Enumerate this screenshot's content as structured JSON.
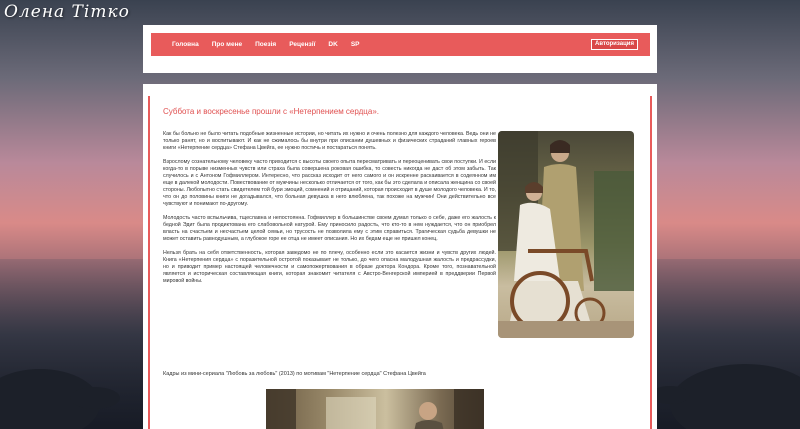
{
  "site": {
    "logo": "Олена Тітко"
  },
  "nav": {
    "items": [
      {
        "label": "Головна"
      },
      {
        "label": "Про мене"
      },
      {
        "label": "Поезія"
      },
      {
        "label": "Рецензії"
      },
      {
        "label": "DK"
      },
      {
        "label": "SP"
      }
    ],
    "auth_label": "Авторизация"
  },
  "article": {
    "title": "Суббота и воскресенье прошли с «Нетерпением сердца».",
    "paragraphs": [
      "Как бы больно не было читать подобные жизненные истории, но читать их нужно и очень полезно для каждого человека. Ведь они не только ранят, но и воспитывают. И как не сжималось бы внутри при описании душевных и физических страданий главных героев книги «Нетерпение сердца» Стефана Цвейга, ее нужно постичь и постараться понять.",
      "Взрослому сознательному человеку часто приходится с высоты своего опыта пересматривать и переоценивать свои поступки. И если когда-то в порыве низменных чувств или страха была совершена роковая ошибка, то совесть никогда не даст об этом забыть. Так случилось и с Антоном Гофмиллером. Интересно, что рассказ исходит от него самого и он искренне раскаивается в содеянном им еще в далекой молодости. Повествование от мужчины несколько отличается от того, как бы это сделала и описала женщина со своей стороны. Любопытно стать свидетелем той бури эмоций, сомнений и отрицаний, которая происходит в душе молодого человека. И то, что он до половины книги не догадывался, что больная девушка в него влюблена, так похоже на мужчин! Они действительно все чувствуют и понимают по-другому.",
      "Молодость часто вспыльчива, тщеславна и непостоянна. Гофмиллер в большинстве своем думал только о себе, даже его жалость к бедной Эдит была продиктована его слабовольной натурой. Ему приносило радость, что кто-то в нем нуждается, что он приобрел власть на счастьем и несчастьем целой семьи, но трусость не позволила ему с этим справиться. Трагическая судьба девушки не может оставить равнодушным, а глубокое горе ее отца не имеет описания. Но их бедам еще не пришел конец.",
      "Нельзя брать на себя ответственность, которая заведомо не по плечу, особенно если это касается жизни и чувств других людей. Книга «Нетерпения сердца» с поразительной остротой показывает не только, до чего опасна малодушная жалость и предрассудки, но и приводит пример настоящей человечности и самопожертвования в образе доктора Кондора. Кроме того, познавательной является и историческая составляющая книги, которая знакомит читателя с Австро-Венгерской империей в преддверии Первой мировой войны."
    ],
    "caption": "Кадры из мини-сериала \"Любовь за любовь\" (2013) по мотивам \"Нетерпение сердца\" Стефана Цвейга"
  }
}
